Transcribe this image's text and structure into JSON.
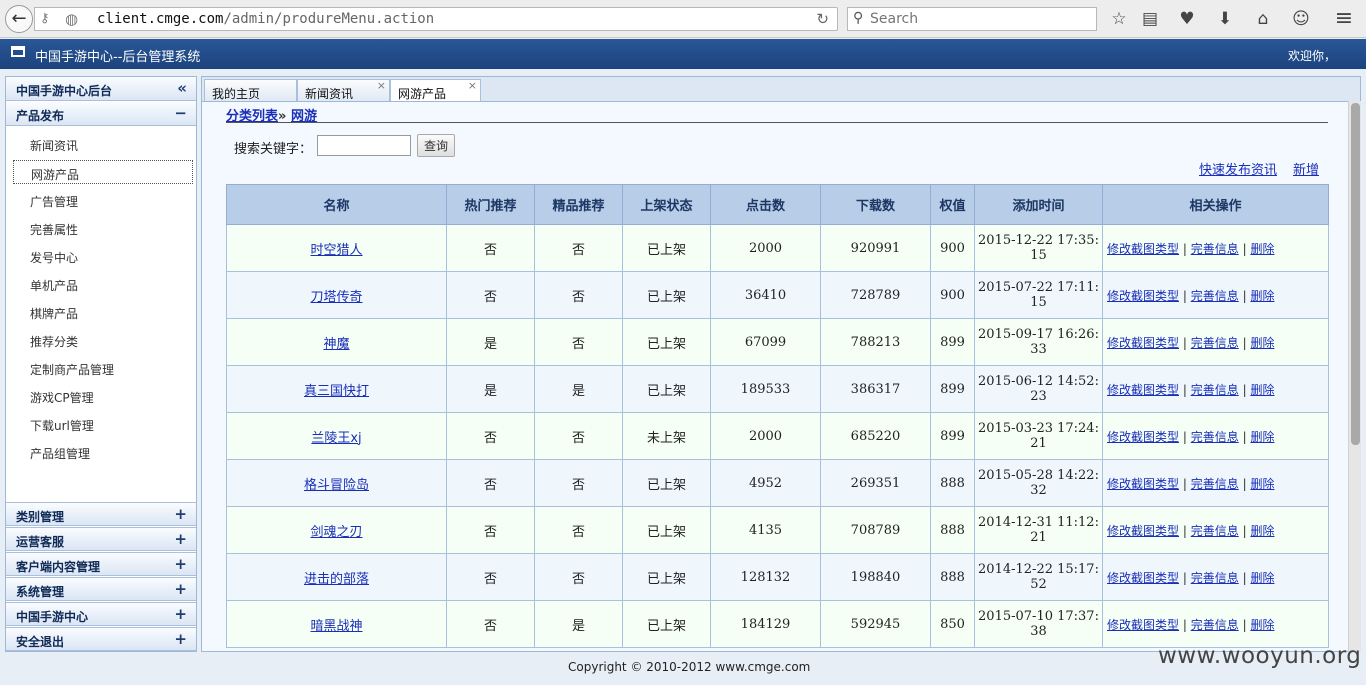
{
  "browser": {
    "url_host": "client.cmge.com",
    "url_path": "/admin/produreMenu.action",
    "search_placeholder": "Search"
  },
  "header": {
    "title": "中国手游中心--后台管理系统",
    "welcome": "欢迎你，"
  },
  "sidebar": {
    "title": "中国手游中心后台",
    "collapse_glyph": "«",
    "open_section": {
      "label": "产品发布",
      "toggle": "−",
      "items": [
        "新闻资讯",
        "网游产品",
        "广告管理",
        "完善属性",
        "发号中心",
        "单机产品",
        "棋牌产品",
        "推荐分类",
        "定制商产品管理",
        "游戏CP管理",
        "下载url管理",
        "产品组管理"
      ],
      "selected_index": 1
    },
    "sections": [
      {
        "label": "类别管理",
        "toggle": "+"
      },
      {
        "label": "运营客服",
        "toggle": "+"
      },
      {
        "label": "客户端内容管理",
        "toggle": "+"
      },
      {
        "label": "系统管理",
        "toggle": "+"
      },
      {
        "label": "中国手游中心",
        "toggle": "+"
      },
      {
        "label": "安全退出",
        "toggle": "+"
      }
    ]
  },
  "tabs": [
    {
      "label": "我的主页",
      "closable": false
    },
    {
      "label": "新闻资讯",
      "closable": true
    },
    {
      "label": "网游产品",
      "closable": true
    }
  ],
  "breadcrumb": {
    "root": "分类列表",
    "separator": "»",
    "current": "网游"
  },
  "search": {
    "label": "搜索关键字：",
    "value": "",
    "button": "查询"
  },
  "top_links": {
    "quick_publish": "快速发布资讯",
    "add": "新增"
  },
  "table": {
    "headers": [
      "名称",
      "热门推荐",
      "精品推荐",
      "上架状态",
      "点击数",
      "下载数",
      "权值",
      "添加时间",
      "相关操作"
    ],
    "ops": [
      "修改截图类型",
      "完善信息",
      "删除"
    ],
    "ops_separator": "|",
    "rows": [
      [
        "时空猎人",
        "否",
        "否",
        "已上架",
        "2000",
        "920991",
        "900",
        "2015-12-22 17:35:15"
      ],
      [
        "刀塔传奇",
        "否",
        "否",
        "已上架",
        "36410",
        "728789",
        "900",
        "2015-07-22 17:11:15"
      ],
      [
        "神魔",
        "是",
        "否",
        "已上架",
        "67099",
        "788213",
        "899",
        "2015-09-17 16:26:33"
      ],
      [
        "真三国快打",
        "是",
        "是",
        "已上架",
        "189533",
        "386317",
        "899",
        "2015-06-12 14:52:23"
      ],
      [
        "兰陵王xj",
        "否",
        "否",
        "未上架",
        "2000",
        "685220",
        "899",
        "2015-03-23 17:24:21"
      ],
      [
        "格斗冒险岛",
        "否",
        "否",
        "已上架",
        "4952",
        "269351",
        "888",
        "2015-05-28 14:22:32"
      ],
      [
        "剑魂之刃",
        "否",
        "否",
        "已上架",
        "4135",
        "708789",
        "888",
        "2014-12-31 11:12:21"
      ],
      [
        "进击的部落",
        "否",
        "否",
        "已上架",
        "128132",
        "198840",
        "888",
        "2014-12-22 15:17:52"
      ],
      [
        "暗黑战神",
        "否",
        "是",
        "已上架",
        "184129",
        "592945",
        "850",
        "2015-07-10 17:37:38"
      ]
    ]
  },
  "footer": {
    "copyright": "Copyright © 2010-2012 www.cmge.com"
  },
  "watermark": "www.wooyun.org",
  "icons": {
    "back": "←",
    "identity": "⚷",
    "globe": "◍",
    "reload": "↻",
    "search": "⚲",
    "bookmark_star": "☆",
    "reading_list": "▤",
    "pocket": "♥",
    "download": "⬇",
    "home": "⌂",
    "chat": "☺",
    "menu": "≡"
  },
  "colors": {
    "header_bg": "#1c437d",
    "link": "#1a2fb8",
    "table_header_bg": "#b7cde8"
  }
}
